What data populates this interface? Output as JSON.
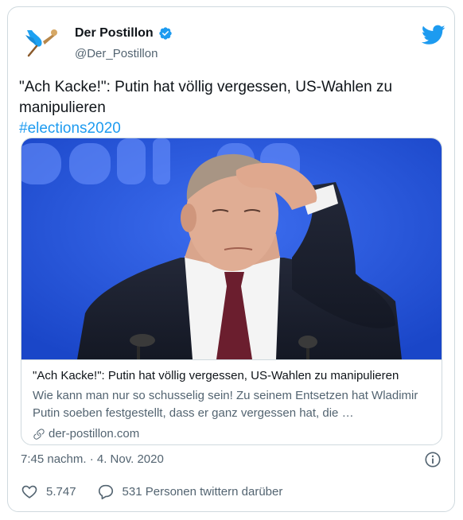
{
  "author": {
    "name": "Der Postillon",
    "handle": "@Der_Postillon",
    "verified": true
  },
  "tweet": {
    "text": "\"Ach Kacke!\": Putin hat völlig vergessen, US-Wahlen zu manipulieren",
    "hashtag": "#elections2020"
  },
  "card": {
    "image_subject": "man-holding-forehead-photo",
    "title": "\"Ach Kacke!\": Putin hat völlig vergessen, US-Wahlen zu manipulieren",
    "description": "Wie kann man nur so schusselig sein! Zu seinem Entsetzen hat Wladimir Putin soeben festgestellt, dass er ganz vergessen hat, die …",
    "domain": "der-postillon.com"
  },
  "meta": {
    "timestamp": "7:45 nachm. · 4. Nov. 2020"
  },
  "actions": {
    "likes": "5.747",
    "replies_label": "531 Personen twittern darüber"
  },
  "colors": {
    "accent": "#1d9bf0",
    "text": "#0f1419",
    "muted": "#536471",
    "border": "#cfd9de"
  }
}
